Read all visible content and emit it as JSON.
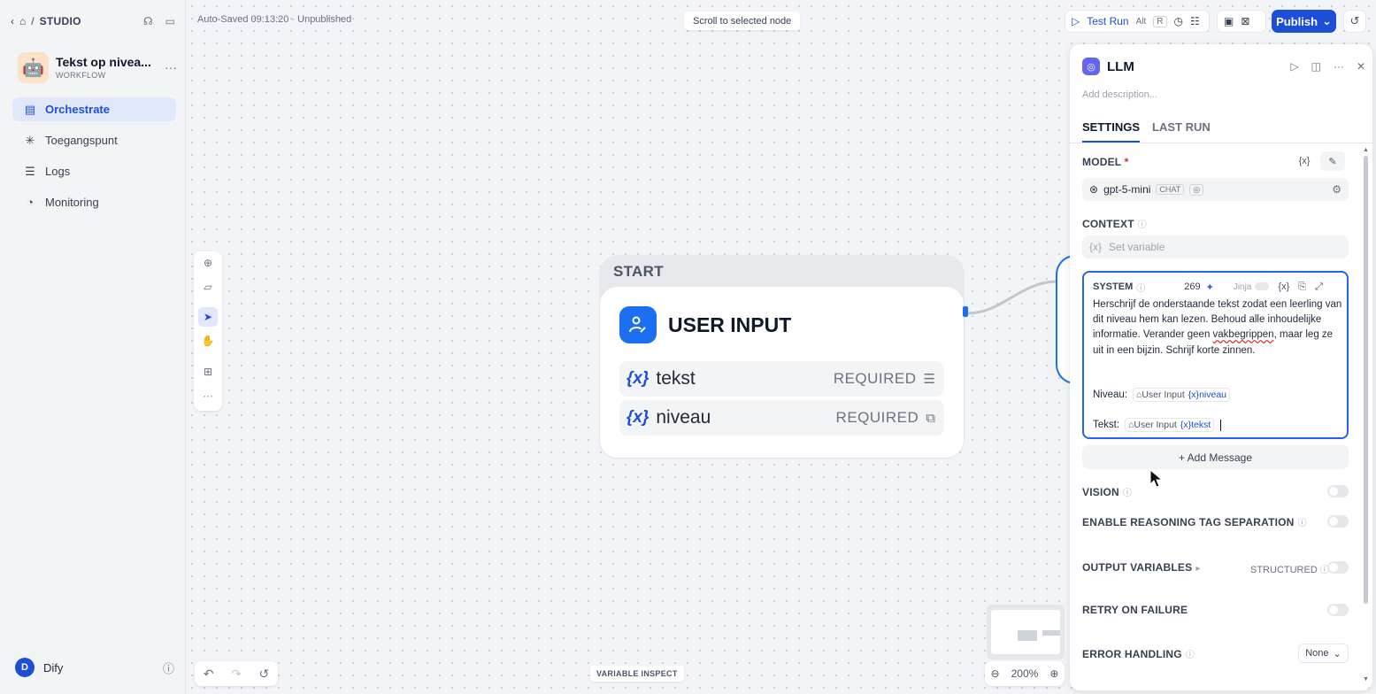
{
  "sidebar": {
    "studio": "STUDIO",
    "app_name": "Tekst op nivea...",
    "app_type": "WORKFLOW",
    "nav": [
      {
        "label": "Orchestrate",
        "active": true
      },
      {
        "label": "Toegangspunt",
        "active": false
      },
      {
        "label": "Logs",
        "active": false
      },
      {
        "label": "Monitoring",
        "active": false
      }
    ],
    "user_initial": "D",
    "user_name": "Dify"
  },
  "canvas": {
    "autosave": "Auto-Saved 09:13:20 · Unpublished",
    "scroll_to_selected": "Scroll to selected node",
    "variable_inspect": "VARIABLE INSPECT",
    "zoom": "200%"
  },
  "start_node": {
    "label": "START",
    "title": "USER INPUT",
    "fields": [
      {
        "name": "tekst",
        "required": "REQUIRED"
      },
      {
        "name": "niveau",
        "required": "REQUIRED"
      }
    ]
  },
  "toolbar": {
    "test_run": "Test Run",
    "shortcut_alt": "Alt",
    "shortcut_key": "R",
    "publish": "Publish"
  },
  "panel": {
    "title": "LLM",
    "description_placeholder": "Add description...",
    "tabs": [
      "SETTINGS",
      "LAST RUN"
    ],
    "model_label": "MODEL",
    "model_name": "gpt-5-mini",
    "model_badge": "CHAT",
    "context_label": "CONTEXT",
    "context_placeholder": "Set variable",
    "system_label": "SYSTEM",
    "system_count": "269",
    "jinja": "Jinja",
    "system_text_1": "Herschrijf de onderstaande tekst zodat een leerling van dit niveau hem kan lezen. Behoud alle inhoudelijke informatie. Verander geen ",
    "system_text_sq": "vakbegrippen",
    "system_text_2": ", maar leg ze uit in een bijzin. Schrijf korte zinnen.",
    "niveau_prefix": "Niveau:",
    "tekst_prefix": "Tekst:",
    "var_source": "User Input",
    "var_niveau": "niveau",
    "var_tekst": "tekst",
    "add_message": "+ Add Message",
    "vision": "VISION",
    "reasoning": "ENABLE REASONING TAG SEPARATION",
    "output_variables": "OUTPUT VARIABLES",
    "structured": "STRUCTURED",
    "retry": "RETRY ON FAILURE",
    "error_handling": "ERROR HANDLING",
    "error_value": "None"
  },
  "colors": {
    "accent": "#1d4ed8",
    "node_icon": "#1d6ff2",
    "llm_icon": "#6366f1"
  }
}
